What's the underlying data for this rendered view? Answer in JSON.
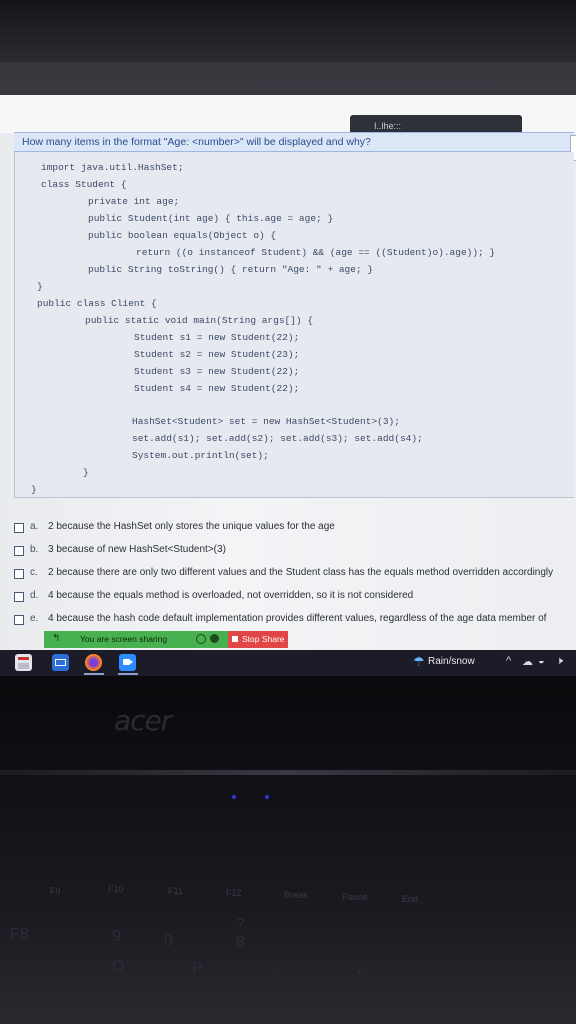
{
  "window": {
    "tooltip_text": "I..lhe:::"
  },
  "question": {
    "text": "How many items in the format \"Age: <number>\" will be displayed and why?"
  },
  "code": {
    "lines": [
      "import java.util.HashSet;",
      "class Student {",
      "private int age;",
      "public Student(int age) { this.age = age; }",
      "public boolean equals(Object o) {",
      "return ((o instanceof Student) && (age == ((Student)o).age)); }",
      "public String toString() { return \"Age: \" + age; }",
      "}",
      "public class Client {",
      "public static void main(String args[]) {",
      "Student s1 = new Student(22);",
      "Student s2 = new Student(23);",
      "Student s3 = new Student(22);",
      "Student s4 = new Student(22);",
      "HashSet<Student> set = new HashSet<Student>(3);",
      "set.add(s1); set.add(s2); set.add(s3); set.add(s4);",
      "System.out.println(set);",
      "}",
      "}"
    ]
  },
  "options": [
    {
      "letter": "a.",
      "text": "2 because the HashSet only stores the unique values for the age"
    },
    {
      "letter": "b.",
      "text": "3 because of new HashSet<Student>(3)"
    },
    {
      "letter": "c.",
      "text": "2 because there are only two different values and the Student class has the equals method overridden accordingly"
    },
    {
      "letter": "d.",
      "text": "4 because the equals method is overloaded, not overridden, so it is not considered"
    },
    {
      "letter": "e.",
      "text": "4 because the hash code default implementation provides different values, regardless of the age data member of"
    }
  ],
  "screen_share": {
    "status": "You are screen sharing",
    "stop_label": "Stop Share"
  },
  "taskbar": {
    "weather": "Rain/snow",
    "icons": [
      "calendar-icon",
      "mail-icon",
      "firefox-icon",
      "zoom-icon"
    ]
  },
  "laptop": {
    "brand": "acer",
    "keys": [
      "F9",
      "F10",
      "F11",
      "F12",
      "Break",
      "Pause",
      "End",
      "F8",
      "?",
      "9",
      "0",
      "O",
      "P",
      "-",
      "8",
      "*"
    ]
  },
  "colors": {
    "question_bar": "#dbe7f6",
    "code_panel": "#e6eaf0",
    "share_green": "#48b04e",
    "stop_red": "#e14646",
    "taskbar": "#1b1c27"
  }
}
